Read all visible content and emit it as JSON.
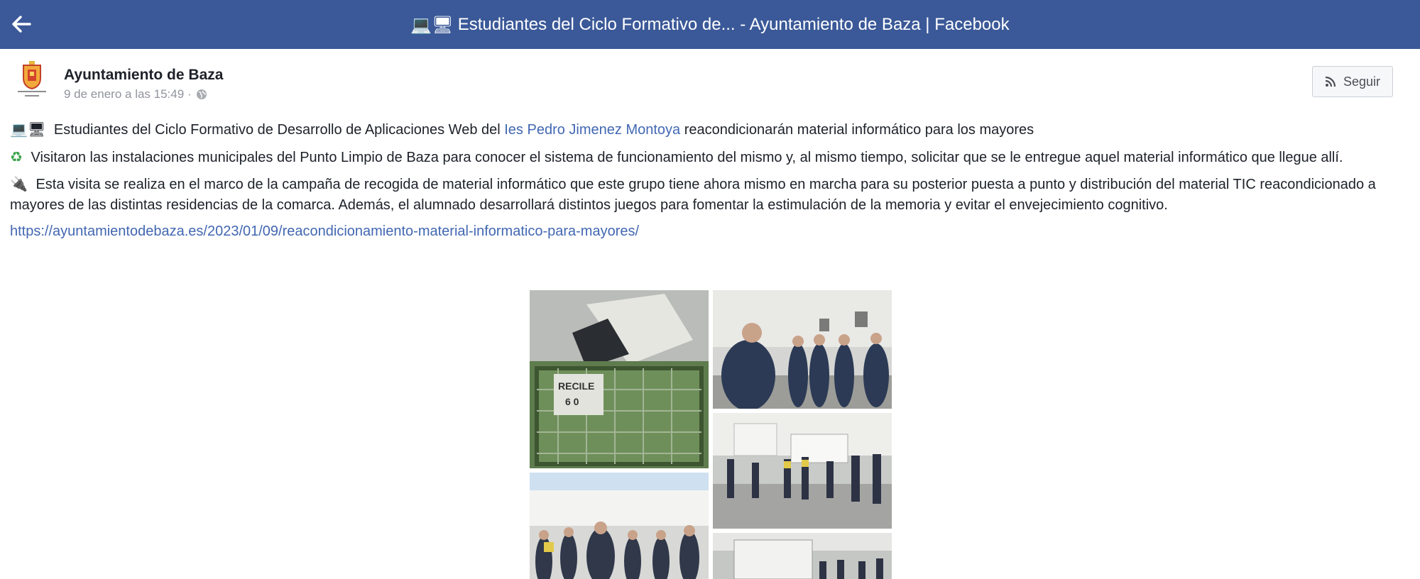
{
  "topbar": {
    "title_emoji": "💻🖥",
    "title": "Estudiantes del Ciclo Formativo de... - Ayuntamiento de Baza | Facebook"
  },
  "post": {
    "author": "Ayuntamiento de Baza",
    "timestamp": "9 de enero a las 15:49 ·",
    "avatar_caption": "Ayuntamiento de Baza",
    "follow_label": "Seguir",
    "paragraphs": {
      "p1_emoji": "💻🖥",
      "p1_before": " Estudiantes del Ciclo Formativo de Desarrollo de Aplicaciones Web del ",
      "p1_link": "Ies Pedro Jimenez Montoya",
      "p1_after": " reacondicionarán material informático para los mayores",
      "p2_emoji": "♻",
      "p2": " Visitaron las instalaciones municipales del Punto Limpio de Baza para conocer el sistema de funcionamiento del mismo y, al mismo tiempo, solicitar que se le entregue aquel material informático que llegue allí.",
      "p3_emoji": "🔌",
      "p3": " Esta visita se realiza en el marco de la campaña de recogida de material informático que este grupo tiene ahora mismo en marcha para su posterior puesta a punto y distribución del material TIC reacondicionado a mayores de las distintas residencias de la comarca. Además, el alumnado desarrollará distintos juegos para fomentar la estimulación de la memoria y evitar el envejecimiento cognitivo.",
      "url": "https://ayuntamientodebaza.es/2023/01/09/reacondicionamiento-material-informatico-para-mayores/"
    },
    "photo_sign_text": "RECILE",
    "photo_sign_subtext": "6 0"
  },
  "colors": {
    "topbar": "#3b5998",
    "link": "#4267b2",
    "muted": "#90949c"
  },
  "icons": [
    "back-arrow-icon",
    "globe-icon",
    "rss-icon"
  ]
}
